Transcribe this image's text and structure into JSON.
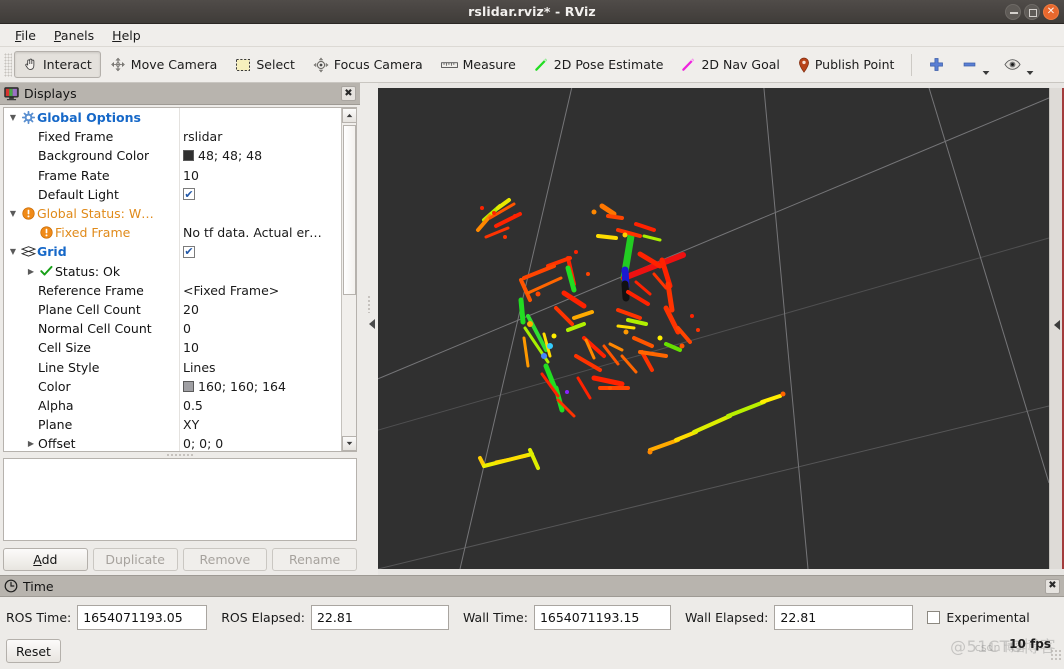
{
  "window": {
    "title": "rslidar.rviz* - RViz",
    "controls": [
      {
        "name": "minimize",
        "glyph": "–"
      },
      {
        "name": "maximize",
        "glyph": "□"
      },
      {
        "name": "close",
        "glyph": "✕"
      }
    ]
  },
  "menubar": {
    "items": [
      {
        "label": "File",
        "mnemonic": "F"
      },
      {
        "label": "Panels",
        "mnemonic": "P"
      },
      {
        "label": "Help",
        "mnemonic": "H"
      }
    ]
  },
  "toolbar": {
    "items": [
      {
        "label": "Interact",
        "icon": "hand-cursor-icon",
        "active": true
      },
      {
        "label": "Move Camera",
        "icon": "move-camera-icon",
        "active": false
      },
      {
        "label": "Select",
        "icon": "selection-box-icon",
        "active": false
      },
      {
        "label": "Focus Camera",
        "icon": "focus-camera-icon",
        "active": false
      },
      {
        "label": "Measure",
        "icon": "ruler-icon",
        "active": false
      },
      {
        "label": "2D Pose Estimate",
        "icon": "green-arrow-icon",
        "active": false
      },
      {
        "label": "2D Nav Goal",
        "icon": "magenta-arrow-icon",
        "active": false
      },
      {
        "label": "Publish Point",
        "icon": "map-pin-icon",
        "active": false
      }
    ],
    "tools": [
      {
        "name": "add-tool-icon",
        "glyph": "+"
      },
      {
        "name": "remove-tool-icon",
        "glyph": "−",
        "dropdown": true
      },
      {
        "name": "visibility-eye-icon",
        "glyph": "◉",
        "dropdown": true
      }
    ]
  },
  "displays": {
    "panel_title": "Displays",
    "panel_icon": "monitor-icon",
    "close_label": "✖",
    "tree": [
      {
        "depth": 0,
        "arrow": "down",
        "icon": "gear-icon",
        "label": "Global Options",
        "style": "head",
        "value": "",
        "value_type": "none"
      },
      {
        "depth": 1,
        "arrow": "none",
        "icon": "",
        "label": "Fixed Frame",
        "style": "plain",
        "value": "rslidar",
        "value_type": "text"
      },
      {
        "depth": 1,
        "arrow": "none",
        "icon": "",
        "label": "Background Color",
        "style": "plain",
        "value": "48; 48; 48",
        "value_type": "color",
        "swatch": "#303030"
      },
      {
        "depth": 1,
        "arrow": "none",
        "icon": "",
        "label": "Frame Rate",
        "style": "plain",
        "value": "10",
        "value_type": "text"
      },
      {
        "depth": 1,
        "arrow": "none",
        "icon": "",
        "label": "Default Light",
        "style": "plain",
        "value": "",
        "value_type": "checkbox",
        "checked": true
      },
      {
        "depth": 0,
        "arrow": "down",
        "icon": "warning-icon",
        "label": "Global Status: W…",
        "style": "warn",
        "value": "",
        "value_type": "none"
      },
      {
        "depth": 1,
        "arrow": "none",
        "icon": "warning-icon",
        "label": "Fixed Frame",
        "style": "warn",
        "value": "No tf data.  Actual er…",
        "value_type": "text"
      },
      {
        "depth": 0,
        "arrow": "down",
        "icon": "grid-icon",
        "label": "Grid",
        "style": "head",
        "value": "",
        "value_type": "checkbox",
        "checked": true
      },
      {
        "depth": 1,
        "arrow": "right",
        "icon": "check-icon",
        "label": "Status: Ok",
        "style": "plain",
        "value": "",
        "value_type": "none"
      },
      {
        "depth": 1,
        "arrow": "none",
        "icon": "",
        "label": "Reference Frame",
        "style": "plain",
        "value": "<Fixed Frame>",
        "value_type": "text"
      },
      {
        "depth": 1,
        "arrow": "none",
        "icon": "",
        "label": "Plane Cell Count",
        "style": "plain",
        "value": "20",
        "value_type": "text"
      },
      {
        "depth": 1,
        "arrow": "none",
        "icon": "",
        "label": "Normal Cell Count",
        "style": "plain",
        "value": "0",
        "value_type": "text"
      },
      {
        "depth": 1,
        "arrow": "none",
        "icon": "",
        "label": "Cell Size",
        "style": "plain",
        "value": "10",
        "value_type": "text"
      },
      {
        "depth": 1,
        "arrow": "none",
        "icon": "",
        "label": "Line Style",
        "style": "plain",
        "value": "Lines",
        "value_type": "text"
      },
      {
        "depth": 1,
        "arrow": "none",
        "icon": "",
        "label": "Color",
        "style": "plain",
        "value": "160; 160; 164",
        "value_type": "color",
        "swatch": "#a0a0a4"
      },
      {
        "depth": 1,
        "arrow": "none",
        "icon": "",
        "label": "Alpha",
        "style": "plain",
        "value": "0.5",
        "value_type": "text"
      },
      {
        "depth": 1,
        "arrow": "none",
        "icon": "",
        "label": "Plane",
        "style": "plain",
        "value": "XY",
        "value_type": "text"
      },
      {
        "depth": 1,
        "arrow": "right",
        "icon": "",
        "label": "Offset",
        "style": "plain",
        "value": "0; 0; 0",
        "value_type": "text"
      }
    ],
    "buttons": [
      {
        "label": "Add",
        "name": "add-display-button",
        "enabled": true,
        "mnemonic": "A"
      },
      {
        "label": "Duplicate",
        "name": "duplicate-display-button",
        "enabled": false,
        "mnemonic": ""
      },
      {
        "label": "Remove",
        "name": "remove-display-button",
        "enabled": false,
        "mnemonic": ""
      },
      {
        "label": "Rename",
        "name": "rename-display-button",
        "enabled": false,
        "mnemonic": ""
      }
    ]
  },
  "render_view": {
    "background_color": "#303030",
    "grid_color": "#a0a0a4",
    "axes": {
      "x_color": "#ff0000",
      "y_color": "#00d000",
      "z_color": "#0000e0"
    }
  },
  "time": {
    "panel_title": "Time",
    "panel_icon": "clock-icon",
    "close_label": "✖",
    "fields": [
      {
        "label": "ROS Time:",
        "value": "1654071193.05",
        "name": "ros-time-field"
      },
      {
        "label": "ROS Elapsed:",
        "value": "22.81",
        "name": "ros-elapsed-field"
      },
      {
        "label": "Wall Time:",
        "value": "1654071193.15",
        "name": "wall-time-field"
      },
      {
        "label": "Wall Elapsed:",
        "value": "22.81",
        "name": "wall-elapsed-field"
      }
    ],
    "experimental_label": "Experimental",
    "experimental_checked": false,
    "reset_label": "Reset",
    "fps_label": "10 fps",
    "watermark": "@51CTO博客",
    "watermark2": "csdn 博客"
  }
}
